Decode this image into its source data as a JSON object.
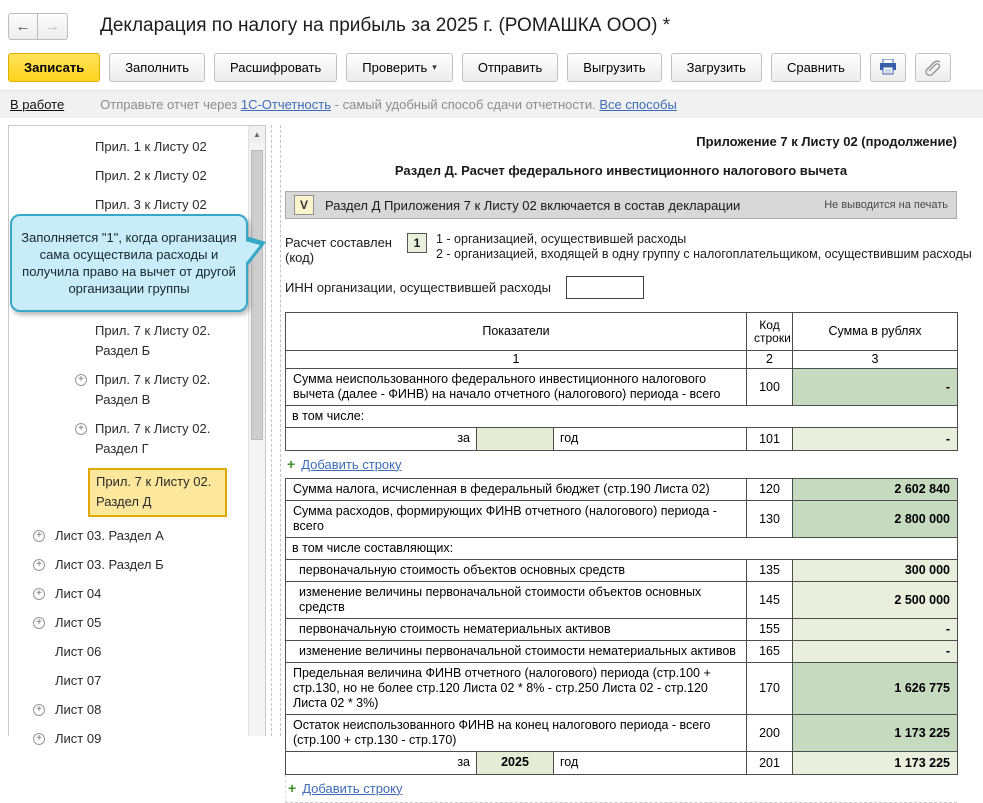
{
  "window": {
    "title": "Декларация по налогу на прибыль за 2025 г. (РОМАШКА ООО) *"
  },
  "icons": {
    "back": "←",
    "forward": "→",
    "caret": "▾",
    "scroll_up": "▲",
    "plus": "+"
  },
  "toolbar": {
    "save": "Записать",
    "fill": "Заполнить",
    "explain": "Расшифровать",
    "check": "Проверить",
    "send": "Отправить",
    "export": "Выгрузить",
    "import": "Загрузить",
    "compare": "Сравнить"
  },
  "statusbar": {
    "state": "В работе",
    "hint_prefix": "Отправьте отчет через ",
    "hint_link": "1С-Отчетность",
    "hint_suffix": " - самый удобный способ сдачи отчетности. ",
    "all_ways_link": "Все способы"
  },
  "sidebar": {
    "items": [
      {
        "label": "Прил. 1 к Листу 02"
      },
      {
        "label": "Прил. 2 к Листу 02"
      },
      {
        "label": "Прил. 3 к Листу 02"
      },
      {
        "label": "Прил. 7 к Листу 02. Раздел Б"
      },
      {
        "label": "Прил. 7 к Листу 02. Раздел В"
      },
      {
        "label": "Прил. 7 к Листу 02. Раздел Г"
      },
      {
        "label": "Прил. 7 к Листу 02. Раздел Д"
      },
      {
        "label": "Лист 03. Раздел А"
      },
      {
        "label": "Лист 03. Раздел Б"
      },
      {
        "label": "Лист 04"
      },
      {
        "label": "Лист 05"
      },
      {
        "label": "Лист 06"
      },
      {
        "label": "Лист 07"
      },
      {
        "label": "Лист 08"
      },
      {
        "label": "Лист 09"
      }
    ]
  },
  "tooltip": {
    "text": "Заполняется \"1\", когда организация сама осуществила расходы и получила право на вычет от другой организации группы"
  },
  "form": {
    "page_header": "Приложение 7 к Листу 02 (продолжение)",
    "section_title": "Раздел Д. Расчет федерального инвестиционного налогового вычета",
    "include_checkbox": {
      "mark": "V",
      "label": "Раздел Д Приложения 7 к Листу 02 включается в состав декларации",
      "note": "Не выводится на печать"
    },
    "calc_code": {
      "label": "Расчет составлен (код)",
      "value": "1",
      "option1": "1 - организацией, осуществившей расходы",
      "option2": "2 - организацией, входящей в одну группу с налогоплательщиком, осуществившим расходы"
    },
    "inn": {
      "label": "ИНН организации, осуществившей расходы",
      "value": ""
    },
    "add_row_label": "Добавить строку"
  },
  "table": {
    "headers": {
      "col1": "Показатели",
      "col2": "Код строки",
      "col3": "Сумма в рублях"
    },
    "col_numbers": {
      "col1": "1",
      "col2": "2",
      "col3": "3"
    },
    "rows": {
      "r100": {
        "label": "Сумма неиспользованного федерального инвестиционного налогового вычета (далее - ФИНВ) на начало отчетного (налогового) периода - всего",
        "code": "100",
        "value": "-"
      },
      "span1": {
        "label": "в том числе:"
      },
      "r101": {
        "za": "за",
        "year": "",
        "god": "год",
        "code": "101",
        "value": "-"
      },
      "r120": {
        "label": "Сумма налога, исчисленная в федеральный бюджет (стр.190 Листа 02)",
        "code": "120",
        "value": "2 602 840"
      },
      "r130": {
        "label": "Сумма расходов, формирующих ФИНВ отчетного (налогового) периода - всего",
        "code": "130",
        "value": "2 800 000"
      },
      "span2": {
        "label": "в том числе составляющих:"
      },
      "r135": {
        "label": "первоначальную стоимость объектов основных средств",
        "code": "135",
        "value": "300 000"
      },
      "r145": {
        "label": "изменение величины первоначальной стоимости объектов основных средств",
        "code": "145",
        "value": "2 500 000"
      },
      "r155": {
        "label": "первоначальную стоимость нематериальных активов",
        "code": "155",
        "value": "-"
      },
      "r165": {
        "label": "изменение величины первоначальной стоимости нематериальных активов",
        "code": "165",
        "value": "-"
      },
      "r170": {
        "label": "Предельная величина ФИНВ отчетного (налогового) периода (стр.100 + стр.130, но не более стр.120 Листа 02 * 8% - стр.250 Листа 02 - стр.120 Листа 02 * 3%)",
        "code": "170",
        "value": "1 626 775"
      },
      "r200": {
        "label": "Остаток неиспользованного ФИНВ на конец налогового периода - всего (стр.100 + стр.130 - стр.170)",
        "code": "200",
        "value": "1 173 225"
      },
      "r201": {
        "za": "за",
        "year": "2025",
        "god": "год",
        "code": "201",
        "value": "1 173 225"
      }
    }
  },
  "colors": {
    "accent_yellow": "#ffd41f",
    "selected_item_bg": "#fce79d",
    "selected_item_border": "#e0a800",
    "cell_green_dark": "#c5dabf",
    "cell_green_light": "#e9efdc",
    "tooltip_bg": "#c8edf8",
    "tooltip_border": "#38a8c8",
    "link_blue": "#3e6cb8"
  }
}
